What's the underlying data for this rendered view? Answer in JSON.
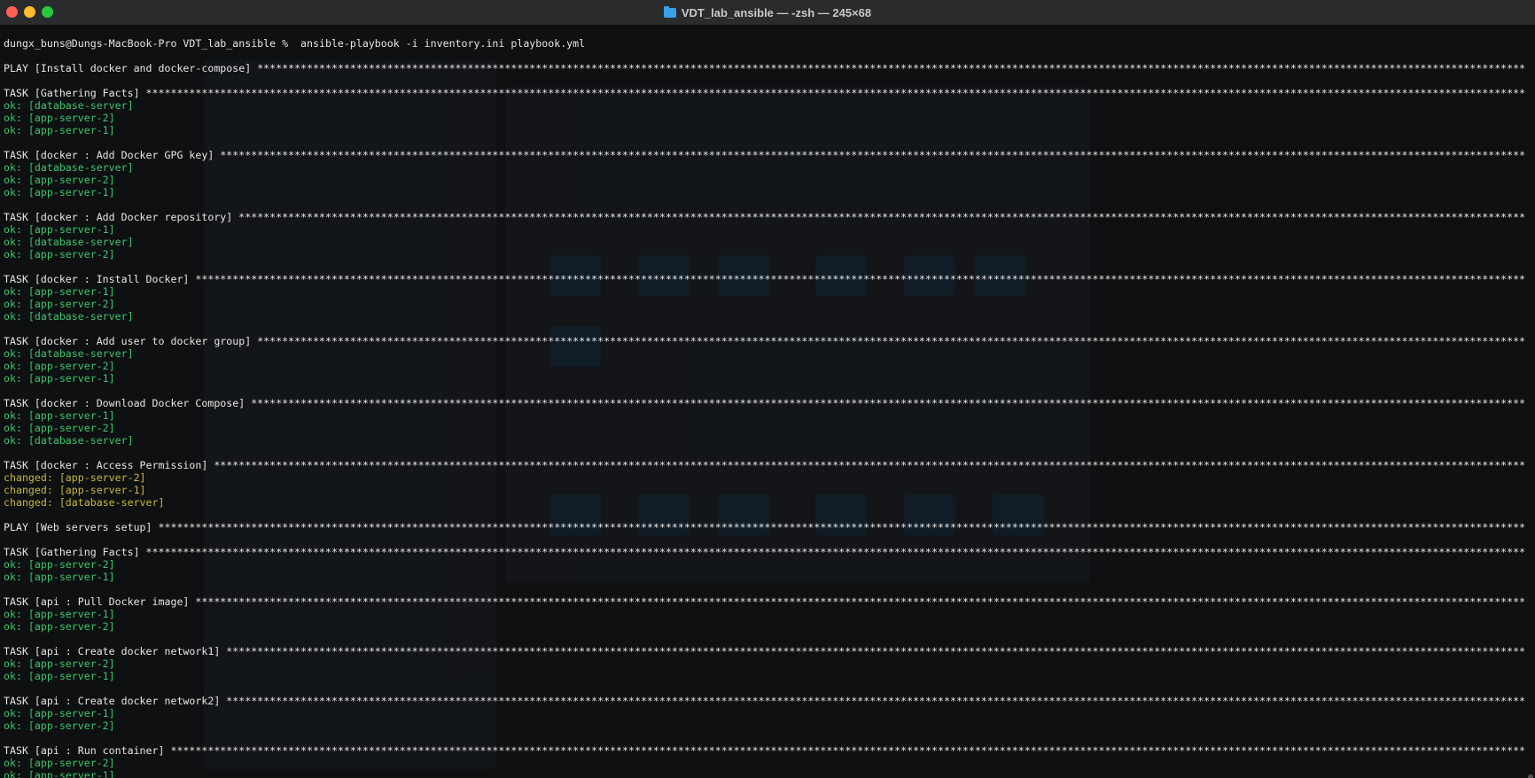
{
  "window": {
    "title": "VDT_lab_ansible — -zsh — 245×68",
    "folder_icon": "folder-icon"
  },
  "terminal": {
    "prompt": "dungx_buns@Dungs-MacBook-Pro VDT_lab_ansible % ",
    "command": " ansible-playbook -i inventory.ini playbook.yml",
    "lines": [
      {
        "kind": "play",
        "text": "PLAY [Install docker and docker-compose] "
      },
      {
        "kind": "blank"
      },
      {
        "kind": "task",
        "text": "TASK [Gathering Facts] "
      },
      {
        "kind": "ok",
        "text": "ok: [database-server]"
      },
      {
        "kind": "ok",
        "text": "ok: [app-server-2]"
      },
      {
        "kind": "ok",
        "text": "ok: [app-server-1]"
      },
      {
        "kind": "blank"
      },
      {
        "kind": "task",
        "text": "TASK [docker : Add Docker GPG key] "
      },
      {
        "kind": "ok",
        "text": "ok: [database-server]"
      },
      {
        "kind": "ok",
        "text": "ok: [app-server-2]"
      },
      {
        "kind": "ok",
        "text": "ok: [app-server-1]"
      },
      {
        "kind": "blank"
      },
      {
        "kind": "task",
        "text": "TASK [docker : Add Docker repository] "
      },
      {
        "kind": "ok",
        "text": "ok: [app-server-1]"
      },
      {
        "kind": "ok",
        "text": "ok: [database-server]"
      },
      {
        "kind": "ok",
        "text": "ok: [app-server-2]"
      },
      {
        "kind": "blank"
      },
      {
        "kind": "task",
        "text": "TASK [docker : Install Docker] "
      },
      {
        "kind": "ok",
        "text": "ok: [app-server-1]"
      },
      {
        "kind": "ok",
        "text": "ok: [app-server-2]"
      },
      {
        "kind": "ok",
        "text": "ok: [database-server]"
      },
      {
        "kind": "blank"
      },
      {
        "kind": "task",
        "text": "TASK [docker : Add user to docker group] "
      },
      {
        "kind": "ok",
        "text": "ok: [database-server]"
      },
      {
        "kind": "ok",
        "text": "ok: [app-server-2]"
      },
      {
        "kind": "ok",
        "text": "ok: [app-server-1]"
      },
      {
        "kind": "blank"
      },
      {
        "kind": "task",
        "text": "TASK [docker : Download Docker Compose] "
      },
      {
        "kind": "ok",
        "text": "ok: [app-server-1]"
      },
      {
        "kind": "ok",
        "text": "ok: [app-server-2]"
      },
      {
        "kind": "ok",
        "text": "ok: [database-server]"
      },
      {
        "kind": "blank"
      },
      {
        "kind": "task",
        "text": "TASK [docker : Access Permission] "
      },
      {
        "kind": "changed",
        "text": "changed: [app-server-2]"
      },
      {
        "kind": "changed",
        "text": "changed: [app-server-1]"
      },
      {
        "kind": "changed",
        "text": "changed: [database-server]"
      },
      {
        "kind": "blank"
      },
      {
        "kind": "play",
        "text": "PLAY [Web servers setup] "
      },
      {
        "kind": "blank"
      },
      {
        "kind": "task",
        "text": "TASK [Gathering Facts] "
      },
      {
        "kind": "ok",
        "text": "ok: [app-server-2]"
      },
      {
        "kind": "ok",
        "text": "ok: [app-server-1]"
      },
      {
        "kind": "blank"
      },
      {
        "kind": "task",
        "text": "TASK [api : Pull Docker image] "
      },
      {
        "kind": "ok",
        "text": "ok: [app-server-1]"
      },
      {
        "kind": "ok",
        "text": "ok: [app-server-2]"
      },
      {
        "kind": "blank"
      },
      {
        "kind": "task",
        "text": "TASK [api : Create docker network1] "
      },
      {
        "kind": "ok",
        "text": "ok: [app-server-2]"
      },
      {
        "kind": "ok",
        "text": "ok: [app-server-1]"
      },
      {
        "kind": "blank"
      },
      {
        "kind": "task",
        "text": "TASK [api : Create docker network2] "
      },
      {
        "kind": "ok",
        "text": "ok: [app-server-1]"
      },
      {
        "kind": "ok",
        "text": "ok: [app-server-2]"
      },
      {
        "kind": "blank"
      },
      {
        "kind": "task",
        "text": "TASK [api : Run container] "
      },
      {
        "kind": "ok",
        "text": "ok: [app-server-2]"
      },
      {
        "kind": "ok",
        "text": "ok: [app-server-1]"
      }
    ]
  },
  "colors": {
    "ok": "#3cc46b",
    "changed": "#c7b93a",
    "text": "#e6e6e6"
  }
}
